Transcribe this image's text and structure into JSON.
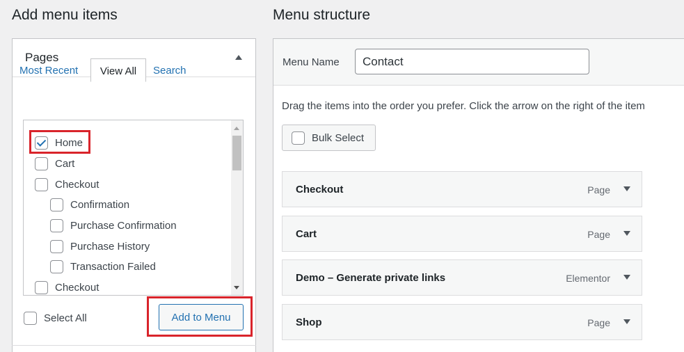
{
  "left": {
    "heading": "Add menu items",
    "panel_title": "Pages",
    "tabs": [
      {
        "label": "Most Recent"
      },
      {
        "label": "View All"
      },
      {
        "label": "Search"
      }
    ],
    "items": [
      {
        "label": "Home",
        "checked": true
      },
      {
        "label": "Cart",
        "checked": false
      },
      {
        "label": "Checkout",
        "checked": false
      },
      {
        "label": "Confirmation",
        "checked": false
      },
      {
        "label": "Purchase Confirmation",
        "checked": false
      },
      {
        "label": "Purchase History",
        "checked": false
      },
      {
        "label": "Transaction Failed",
        "checked": false
      },
      {
        "label": "Checkout",
        "checked": false
      }
    ],
    "select_all_label": "Select All",
    "add_button_label": "Add to Menu"
  },
  "right": {
    "heading": "Menu structure",
    "menu_name_label": "Menu Name",
    "menu_name_value": "Contact",
    "instructions": "Drag the items into the order you prefer. Click the arrow on the right of the item",
    "bulk_select_label": "Bulk Select",
    "menu_items": [
      {
        "title": "Checkout",
        "type": "Page"
      },
      {
        "title": "Cart",
        "type": "Page"
      },
      {
        "title": "Demo – Generate private links",
        "type": "Elementor"
      },
      {
        "title": "Shop",
        "type": "Page"
      }
    ]
  },
  "colors": {
    "accent": "#2271b1",
    "highlight": "#d9242b",
    "background": "#f0f0f1"
  }
}
